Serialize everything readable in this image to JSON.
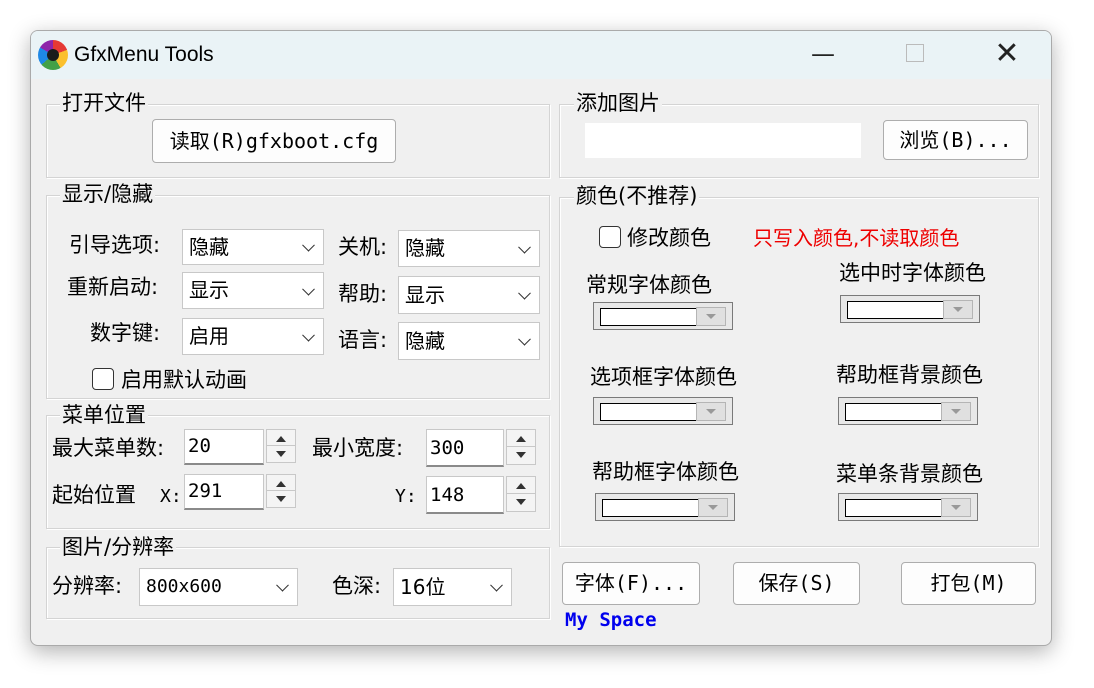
{
  "window": {
    "title": "GfxMenu Tools",
    "minimize": "—",
    "close": "✕"
  },
  "open_file": {
    "legend": "打开文件",
    "read_button": "读取(R)gfxboot.cfg"
  },
  "show_hide": {
    "legend": "显示/隐藏",
    "boot_options_label": "引导选项:",
    "boot_options_value": "隐藏",
    "shutdown_label": "关机:",
    "shutdown_value": "隐藏",
    "restart_label": "重新启动:",
    "restart_value": "显示",
    "help_label": "帮助:",
    "help_value": "显示",
    "numkey_label": "数字键:",
    "numkey_value": "启用",
    "language_label": "语言:",
    "language_value": "隐藏",
    "default_anim_label": "启用默认动画"
  },
  "menu_position": {
    "legend": "菜单位置",
    "max_items_label": "最大菜单数:",
    "max_items_value": "20",
    "min_width_label": "最小宽度:",
    "min_width_value": "300",
    "start_pos_label": "起始位置",
    "x_label": "X:",
    "x_value": "291",
    "y_label": "Y:",
    "y_value": "148"
  },
  "image_resolution": {
    "legend": "图片/分辨率",
    "resolution_label": "分辨率:",
    "resolution_value": "800x600",
    "depth_label": "色深:",
    "depth_value": "16位"
  },
  "add_image": {
    "legend": "添加图片",
    "path_value": "",
    "browse_button": "浏览(B)..."
  },
  "colors": {
    "legend": "颜色(不推荐)",
    "modify_label": "修改颜色",
    "warning": "只写入颜色,不读取颜色",
    "normal_font": "常规字体颜色",
    "selected_font": "选中时字体颜色",
    "option_box_font": "选项框字体颜色",
    "help_box_bg": "帮助框背景颜色",
    "help_box_font": "帮助框字体颜色",
    "menubar_bg": "菜单条背景颜色",
    "swatch_color": "#ffffff",
    "warning_color": "#ee0000"
  },
  "buttons": {
    "font": "字体(F)...",
    "save": "保存(S)",
    "pack": "打包(M)"
  },
  "footer": {
    "my_space": "My Space",
    "link_color": "#0000ee"
  }
}
